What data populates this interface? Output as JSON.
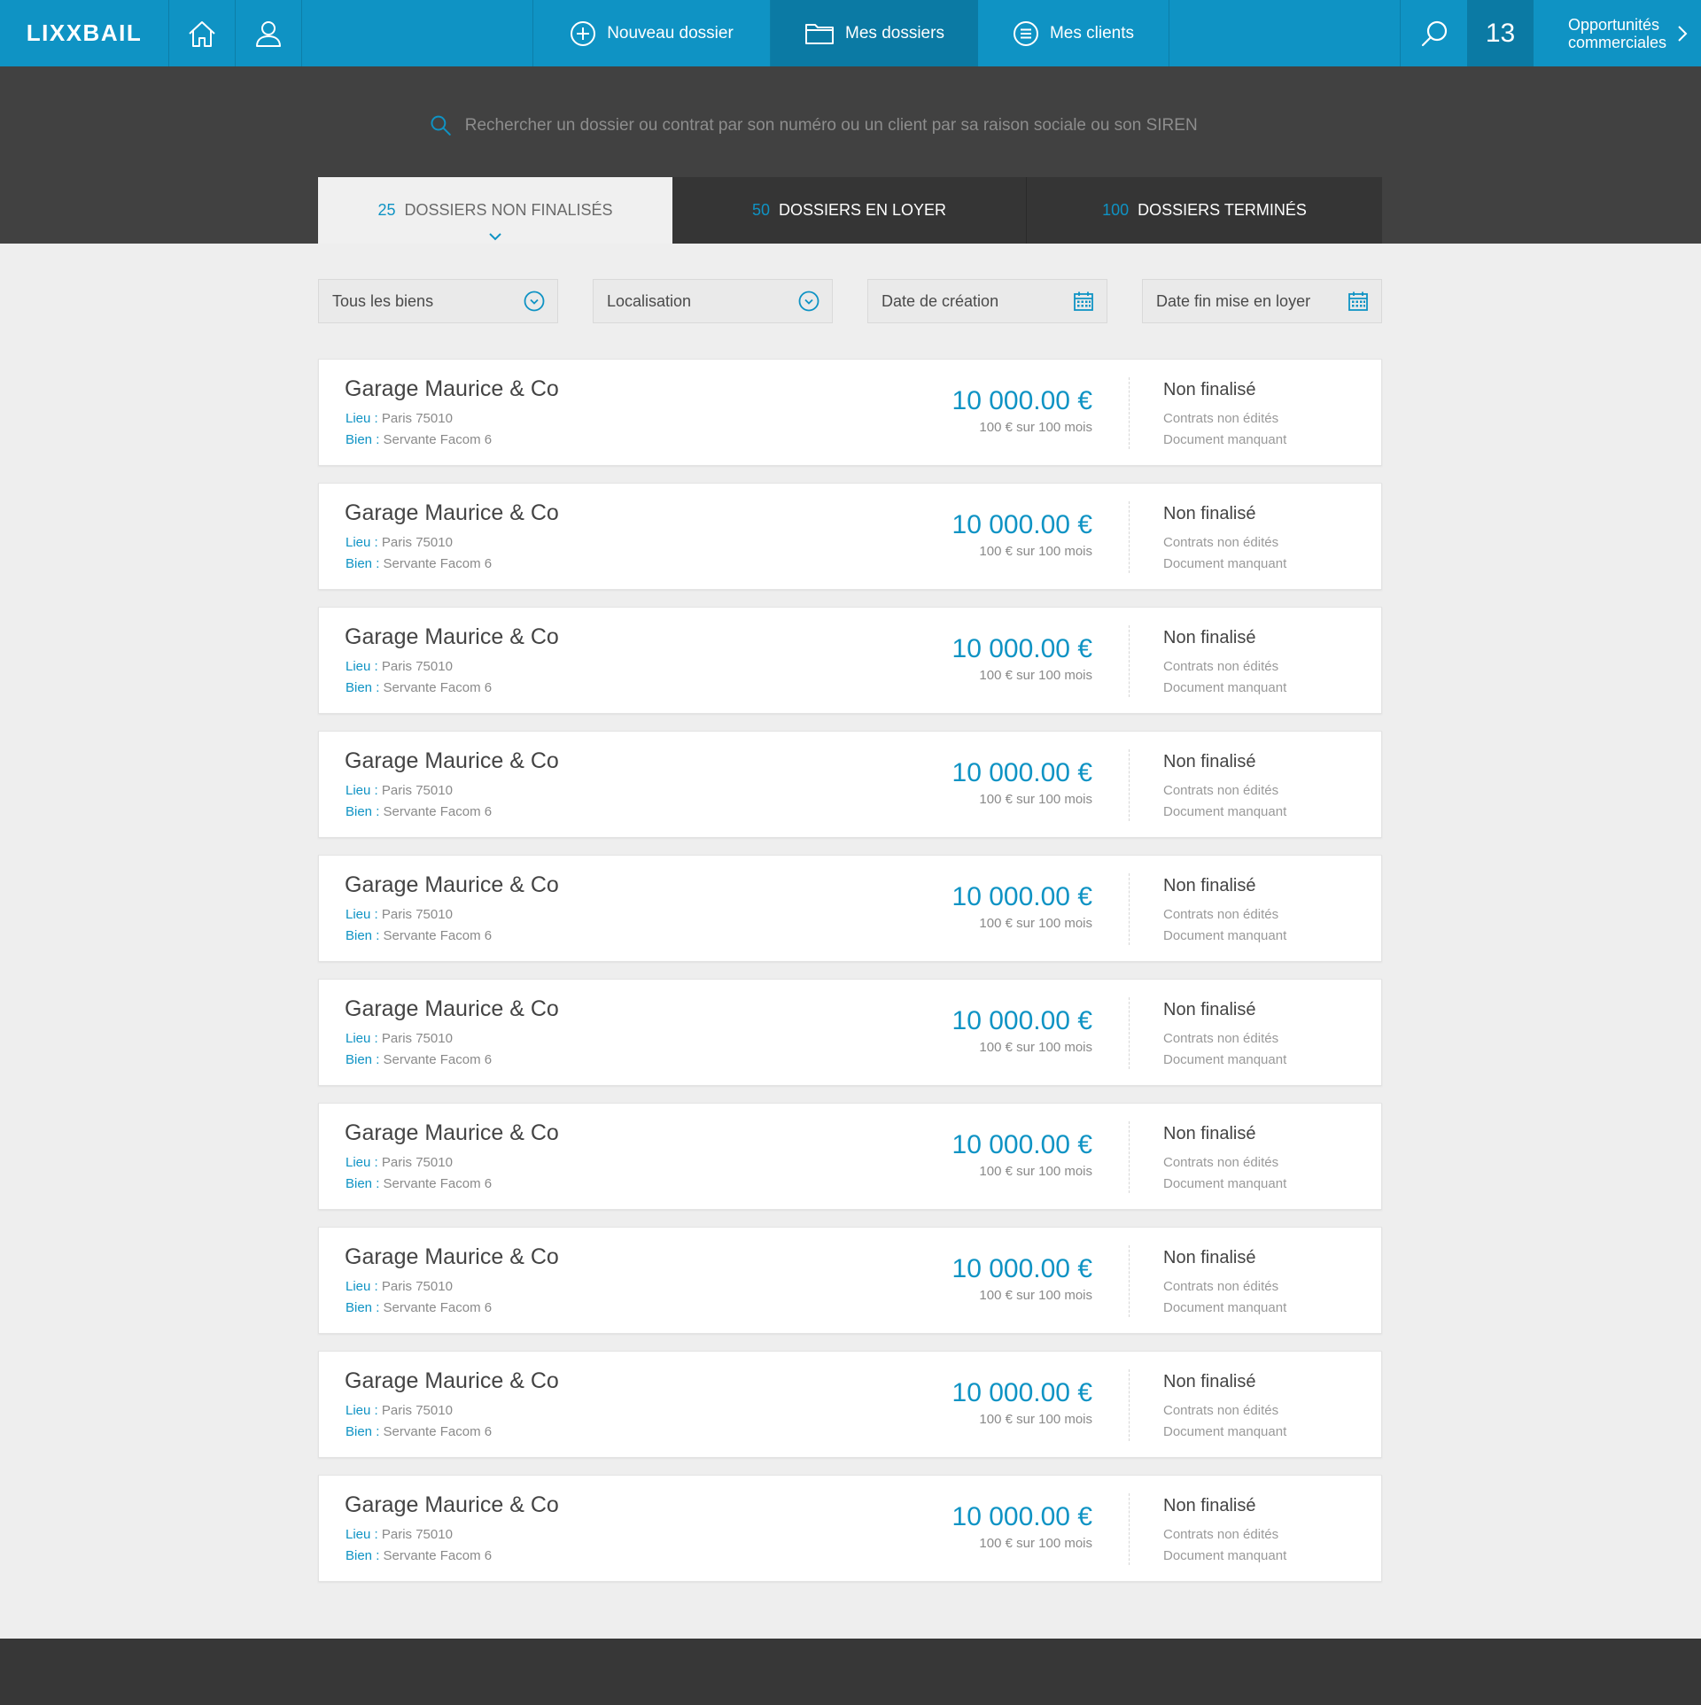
{
  "brand": {
    "logo": "LIXXBAIL"
  },
  "nav": {
    "new_folder": "Nouveau dossier",
    "my_folders": "Mes dossiers",
    "my_clients": "Mes clients",
    "count": "13",
    "opportunities_line1": "Opportunités",
    "opportunities_line2": "commerciales"
  },
  "search": {
    "placeholder": "Rechercher un dossier ou contrat par son numéro ou un client par sa raison sociale ou son SIREN"
  },
  "tabs": [
    {
      "count": "25",
      "label": "DOSSIERS NON FINALISÉS"
    },
    {
      "count": "50",
      "label": "DOSSIERS EN LOYER"
    },
    {
      "count": "100",
      "label": "DOSSIERS TERMINÉS"
    }
  ],
  "filters": [
    {
      "label": "Tous les biens",
      "icon": "chevron-down-circle-icon"
    },
    {
      "label": "Localisation",
      "icon": "chevron-down-circle-icon"
    },
    {
      "label": "Date de création",
      "icon": "calendar-icon"
    },
    {
      "label": "Date fin mise en loyer",
      "icon": "calendar-icon"
    }
  ],
  "colors": {
    "primary": "#0f93c4",
    "primary_dark": "#0b7aa4",
    "band": "#414141",
    "footer": "#373737"
  },
  "dossiers": [
    {
      "name": "Garage Maurice & Co",
      "lieu_key": "Lieu :",
      "lieu": "Paris 75010",
      "bien_key": "Bien :",
      "bien": "Servante Facom 6",
      "amount": "10 000.00 €",
      "terms": "100 € sur 100 mois",
      "status": "Non finalisé",
      "note1": "Contrats non édités",
      "note2": "Document manquant"
    },
    {
      "name": "Garage Maurice & Co",
      "lieu_key": "Lieu :",
      "lieu": "Paris 75010",
      "bien_key": "Bien :",
      "bien": "Servante Facom 6",
      "amount": "10 000.00 €",
      "terms": "100 € sur 100 mois",
      "status": "Non finalisé",
      "note1": "Contrats non édités",
      "note2": "Document manquant"
    },
    {
      "name": "Garage Maurice & Co",
      "lieu_key": "Lieu :",
      "lieu": "Paris 75010",
      "bien_key": "Bien :",
      "bien": "Servante Facom 6",
      "amount": "10 000.00 €",
      "terms": "100 € sur 100 mois",
      "status": "Non finalisé",
      "note1": "Contrats non édités",
      "note2": "Document manquant"
    },
    {
      "name": "Garage Maurice & Co",
      "lieu_key": "Lieu :",
      "lieu": "Paris 75010",
      "bien_key": "Bien :",
      "bien": "Servante Facom 6",
      "amount": "10 000.00 €",
      "terms": "100 € sur 100 mois",
      "status": "Non finalisé",
      "note1": "Contrats non édités",
      "note2": "Document manquant"
    },
    {
      "name": "Garage Maurice & Co",
      "lieu_key": "Lieu :",
      "lieu": "Paris 75010",
      "bien_key": "Bien :",
      "bien": "Servante Facom 6",
      "amount": "10 000.00 €",
      "terms": "100 € sur 100 mois",
      "status": "Non finalisé",
      "note1": "Contrats non édités",
      "note2": "Document manquant"
    },
    {
      "name": "Garage Maurice & Co",
      "lieu_key": "Lieu :",
      "lieu": "Paris 75010",
      "bien_key": "Bien :",
      "bien": "Servante Facom 6",
      "amount": "10 000.00 €",
      "terms": "100 € sur 100 mois",
      "status": "Non finalisé",
      "note1": "Contrats non édités",
      "note2": "Document manquant"
    },
    {
      "name": "Garage Maurice & Co",
      "lieu_key": "Lieu :",
      "lieu": "Paris 75010",
      "bien_key": "Bien :",
      "bien": "Servante Facom 6",
      "amount": "10 000.00 €",
      "terms": "100 € sur 100 mois",
      "status": "Non finalisé",
      "note1": "Contrats non édités",
      "note2": "Document manquant"
    },
    {
      "name": "Garage Maurice & Co",
      "lieu_key": "Lieu :",
      "lieu": "Paris 75010",
      "bien_key": "Bien :",
      "bien": "Servante Facom 6",
      "amount": "10 000.00 €",
      "terms": "100 € sur 100 mois",
      "status": "Non finalisé",
      "note1": "Contrats non édités",
      "note2": "Document manquant"
    },
    {
      "name": "Garage Maurice & Co",
      "lieu_key": "Lieu :",
      "lieu": "Paris 75010",
      "bien_key": "Bien :",
      "bien": "Servante Facom 6",
      "amount": "10 000.00 €",
      "terms": "100 € sur 100 mois",
      "status": "Non finalisé",
      "note1": "Contrats non édités",
      "note2": "Document manquant"
    },
    {
      "name": "Garage Maurice & Co",
      "lieu_key": "Lieu :",
      "lieu": "Paris 75010",
      "bien_key": "Bien :",
      "bien": "Servante Facom 6",
      "amount": "10 000.00 €",
      "terms": "100 € sur 100 mois",
      "status": "Non finalisé",
      "note1": "Contrats non édités",
      "note2": "Document manquant"
    }
  ]
}
